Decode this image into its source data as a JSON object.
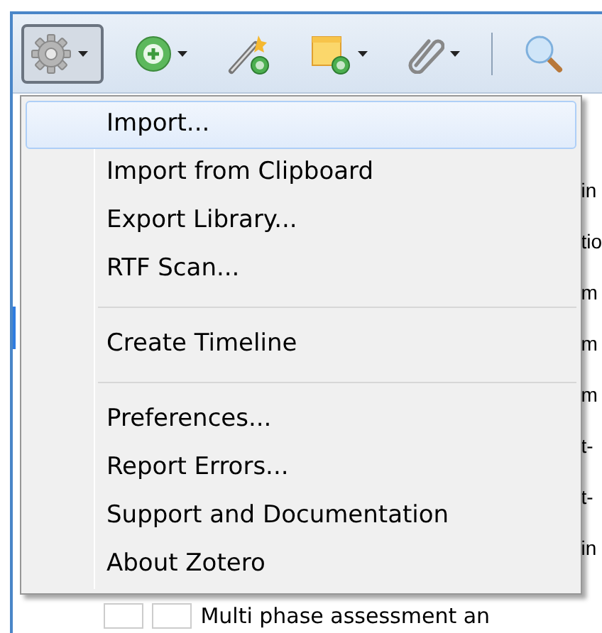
{
  "toolbar": {
    "buttons": [
      {
        "kind": "gear",
        "dropdown": true,
        "selected": true
      },
      {
        "kind": "add",
        "dropdown": true,
        "selected": false
      },
      {
        "kind": "wand",
        "dropdown": false,
        "selected": false
      },
      {
        "kind": "note",
        "dropdown": true,
        "selected": false
      },
      {
        "kind": "attach",
        "dropdown": true,
        "selected": false
      },
      {
        "kind": "separator"
      },
      {
        "kind": "search",
        "dropdown": false,
        "selected": false
      }
    ]
  },
  "list": {
    "rows": [
      {
        "text": "in"
      },
      {
        "text": "tio"
      },
      {
        "text": "m"
      },
      {
        "text": "m"
      },
      {
        "text": "m"
      },
      {
        "text": "t-"
      },
      {
        "text": "t-"
      },
      {
        "text": "in"
      }
    ],
    "last_row": "Multi phase assessment an"
  },
  "menu": {
    "items": [
      {
        "kind": "item",
        "label": "Import...",
        "selected": true
      },
      {
        "kind": "item",
        "label": "Import from Clipboard",
        "selected": false
      },
      {
        "kind": "item",
        "label": "Export Library...",
        "selected": false
      },
      {
        "kind": "item",
        "label": "RTF Scan...",
        "selected": false
      },
      {
        "kind": "separator"
      },
      {
        "kind": "item",
        "label": "Create Timeline",
        "selected": false
      },
      {
        "kind": "separator"
      },
      {
        "kind": "item",
        "label": "Preferences...",
        "selected": false
      },
      {
        "kind": "item",
        "label": "Report Errors...",
        "selected": false
      },
      {
        "kind": "item",
        "label": "Support and Documentation",
        "selected": false
      },
      {
        "kind": "item",
        "label": "About Zotero",
        "selected": false
      }
    ]
  }
}
